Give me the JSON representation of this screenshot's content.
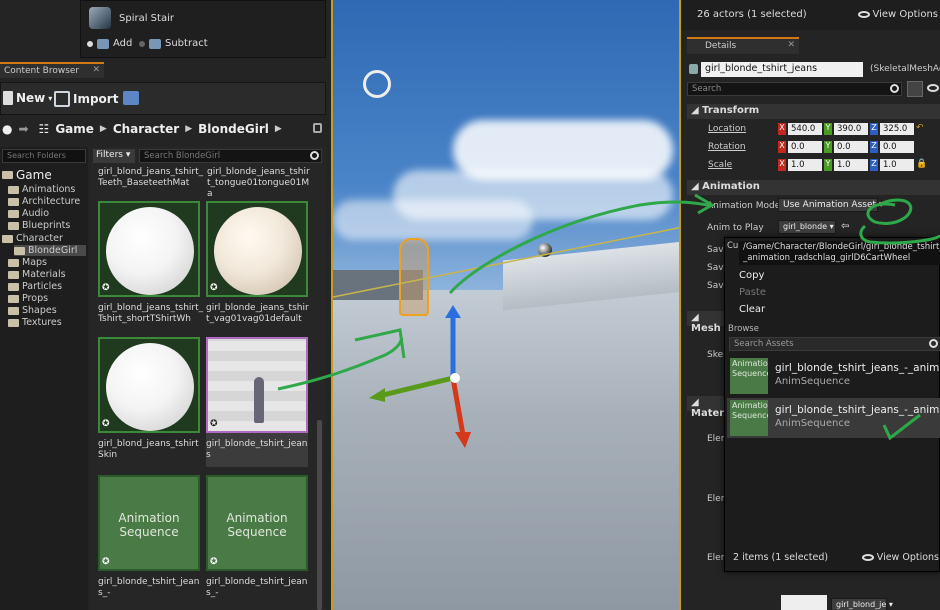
{
  "mode_panel": {
    "spiral_stair": "Spiral Stair",
    "add": "Add",
    "subtract": "Subtract"
  },
  "content_browser": {
    "tab": "Content Browser",
    "new_label": "New",
    "import_label": "Import",
    "path": [
      "Game",
      "Character",
      "BlondeGirl"
    ],
    "folder_search_placeholder": "Search Folders",
    "filters_label": "Filters",
    "asset_search_placeholder": "Search BlondeGirl",
    "folders": [
      {
        "label": "Game"
      },
      {
        "label": "Animations"
      },
      {
        "label": "Architecture"
      },
      {
        "label": "Audio"
      },
      {
        "label": "Blueprints"
      },
      {
        "label": "Character"
      },
      {
        "label": "BlondeGirl"
      },
      {
        "label": "Maps"
      },
      {
        "label": "Materials"
      },
      {
        "label": "Particles"
      },
      {
        "label": "Props"
      },
      {
        "label": "Shapes"
      },
      {
        "label": "Textures"
      }
    ],
    "top_names": [
      "girl_blond_jeans_tshirt_Teeth_BaseteethMat",
      "girl_blonde_jeans_tshirt_tongue01tongue01Ma"
    ],
    "assets": [
      {
        "name": "girl_blond_jeans_tshirt_Tshirt_shortTShirtWh",
        "kind": "material"
      },
      {
        "name": "girl_blonde_jeans_tshirt_vag01vag01default",
        "kind": "material-warm"
      },
      {
        "name": "girl_blond_jeans_tshirt Skin",
        "kind": "material"
      },
      {
        "name": "girl_blonde_tshirt_jeans",
        "kind": "skeletal-mesh"
      },
      {
        "name": "girl_blonde_tshirt_jeans_-",
        "kind": "animation",
        "thumb_label": "Animation Sequence"
      },
      {
        "name": "girl_blonde_tshirt_jeans_-",
        "kind": "animation",
        "thumb_label": "Animation Sequence"
      }
    ]
  },
  "outliner": {
    "actor_count": "26 actors (1 selected)",
    "view_options": "View Options"
  },
  "details": {
    "tab": "Details",
    "actor_name": "girl_blonde_tshirt_jeans",
    "actor_class": "(SkeletalMeshAct",
    "search_placeholder": "Search",
    "transform": {
      "title": "Transform",
      "location_label": "Location",
      "location": [
        "540.0",
        "390.0",
        "325.0"
      ],
      "rotation_label": "Rotation",
      "rotation": [
        "0.0",
        "0.0",
        "0.0"
      ],
      "scale_label": "Scale",
      "scale": [
        "1.0",
        "1.0",
        "1.0"
      ]
    },
    "animation": {
      "title": "Animation",
      "mode_label": "Animation Mode",
      "mode_value": "Use Animation Asset",
      "anim_to_play_label": "Anim to Play",
      "anim_to_play_value": "girl_blonde",
      "save_labels": [
        "Save",
        "Save",
        "Save"
      ]
    },
    "mesh_title": "Mesh",
    "skel_label": "Skel",
    "material_title": "Mater",
    "element_labels": [
      "Elem",
      "Elem",
      "Elem"
    ],
    "bottom_combo": "girl_blond_je"
  },
  "asset_picker": {
    "current_path": "/Game/Character/BlondeGirl/girl_blonde_tshirt_jeans_-_animation_radschlag_girlD6CartWheel",
    "cut_prefix": "Cu",
    "copy": "Copy",
    "paste": "Paste",
    "clear": "Clear",
    "browse_label": "Browse",
    "search_placeholder": "Search Assets",
    "results": [
      {
        "name": "girl_blonde_tshirt_jeans_-_animation_",
        "type": "AnimSequence",
        "thumb": "Animation Sequence"
      },
      {
        "name": "girl_blonde_tshirt_jeans_-_animation_",
        "type": "AnimSequence",
        "thumb": "Animation Sequence"
      }
    ],
    "footer": "2 items (1 selected)",
    "view_options": "View Options"
  }
}
